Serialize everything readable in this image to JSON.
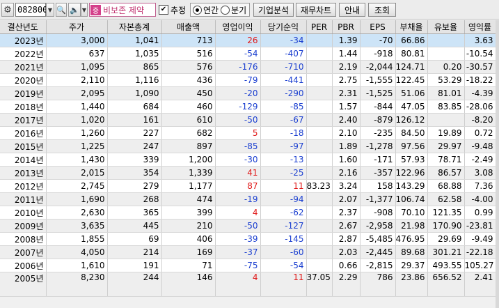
{
  "toolbar": {
    "gear_icon": "⚙",
    "stock_code": "082800",
    "search_icon": "🔍",
    "sound_icon": "🔈",
    "name_chip": "증",
    "stock_name": "비보존 제약",
    "check_mark": "✔",
    "checkbox_label": "추정",
    "radio_annual": "연간",
    "radio_quarter": "분기",
    "btn_company": "기업분석",
    "btn_chart": "재무차트",
    "btn_guide": "안내",
    "btn_query": "조회"
  },
  "table": {
    "headers": [
      "결산년도",
      "주가",
      "자본총계",
      "매출액",
      "영업이익",
      "당기순익",
      "PER",
      "PBR",
      "EPS",
      "부채율",
      "유보율",
      "영익률"
    ],
    "rows": [
      [
        "2023년",
        "3,000",
        "1,041",
        "713",
        "26",
        "-34",
        "",
        "1.39",
        "-70",
        "66.86",
        "",
        "3.63"
      ],
      [
        "2022년",
        "637",
        "1,035",
        "516",
        "-54",
        "-407",
        "",
        "1.44",
        "-918",
        "80.81",
        "",
        "-10.54"
      ],
      [
        "2021년",
        "1,095",
        "865",
        "576",
        "-176",
        "-710",
        "",
        "2.19",
        "-2,044",
        "124.71",
        "0.20",
        "-30.57"
      ],
      [
        "2020년",
        "2,110",
        "1,116",
        "436",
        "-79",
        "-441",
        "",
        "2.75",
        "-1,555",
        "122.45",
        "53.29",
        "-18.22"
      ],
      [
        "2019년",
        "2,095",
        "1,090",
        "450",
        "-20",
        "-290",
        "",
        "2.31",
        "-1,525",
        "51.06",
        "81.01",
        "-4.39"
      ],
      [
        "2018년",
        "1,440",
        "684",
        "460",
        "-129",
        "-85",
        "",
        "1.57",
        "-844",
        "47.05",
        "83.85",
        "-28.06"
      ],
      [
        "2017년",
        "1,020",
        "161",
        "610",
        "-50",
        "-67",
        "",
        "2.40",
        "-879",
        "126.12",
        "",
        "-8.20"
      ],
      [
        "2016년",
        "1,260",
        "227",
        "682",
        "5",
        "-18",
        "",
        "2.10",
        "-235",
        "84.50",
        "19.89",
        "0.72"
      ],
      [
        "2015년",
        "1,225",
        "247",
        "897",
        "-85",
        "-97",
        "",
        "1.89",
        "-1,278",
        "97.56",
        "29.97",
        "-9.48"
      ],
      [
        "2014년",
        "1,430",
        "339",
        "1,200",
        "-30",
        "-13",
        "",
        "1.60",
        "-171",
        "57.93",
        "78.71",
        "-2.49"
      ],
      [
        "2013년",
        "2,015",
        "354",
        "1,339",
        "41",
        "-25",
        "",
        "2.16",
        "-357",
        "122.96",
        "86.57",
        "3.08"
      ],
      [
        "2012년",
        "2,745",
        "279",
        "1,177",
        "87",
        "11",
        "83.23",
        "3.24",
        "158",
        "143.29",
        "68.88",
        "7.36"
      ],
      [
        "2011년",
        "1,690",
        "268",
        "474",
        "-19",
        "-94",
        "",
        "2.07",
        "-1,377",
        "106.74",
        "62.58",
        "-4.00"
      ],
      [
        "2010년",
        "2,630",
        "365",
        "399",
        "4",
        "-62",
        "",
        "2.37",
        "-908",
        "70.10",
        "121.35",
        "0.99"
      ],
      [
        "2009년",
        "3,635",
        "445",
        "210",
        "-50",
        "-127",
        "",
        "2.67",
        "-2,958",
        "21.98",
        "170.90",
        "-23.81"
      ],
      [
        "2008년",
        "1,855",
        "69",
        "406",
        "-39",
        "-145",
        "",
        "2.87",
        "-5,485",
        "476.95",
        "29.69",
        "-9.49"
      ],
      [
        "2007년",
        "4,050",
        "214",
        "169",
        "-37",
        "-60",
        "",
        "2.03",
        "-2,445",
        "89.68",
        "301.21",
        "-22.18"
      ],
      [
        "2006년",
        "1,610",
        "191",
        "71",
        "-75",
        "-54",
        "",
        "0.66",
        "-2,815",
        "29.37",
        "493.55",
        "105.27"
      ],
      [
        "2005년",
        "8,230",
        "244",
        "146",
        "4",
        "11",
        "37.05",
        "2.29",
        "786",
        "23.86",
        "656.52",
        "2.41"
      ]
    ]
  },
  "colors": {
    "negative": "#1b3fd0",
    "positive": "#e01818",
    "selected_row": "#cde4f7"
  }
}
